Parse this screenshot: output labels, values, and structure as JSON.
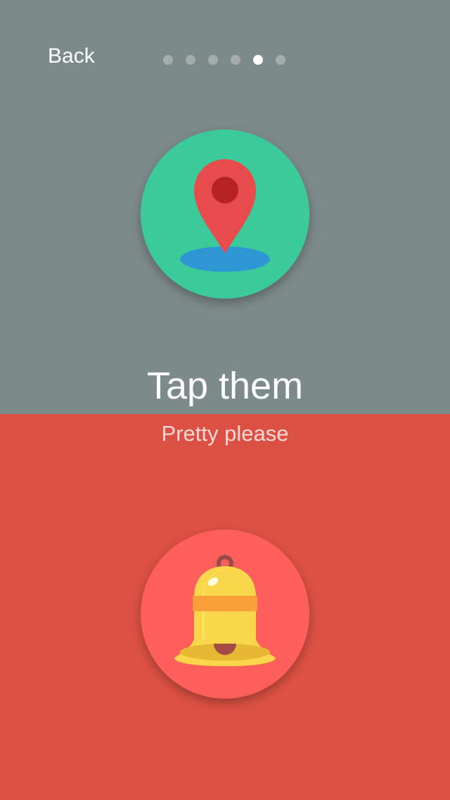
{
  "nav": {
    "back_label": "Back",
    "page_count": 6,
    "active_page": 5
  },
  "onboarding": {
    "title": "Tap them",
    "subtitle": "Pretty please",
    "icons": [
      "map-pin-icon",
      "bell-icon"
    ]
  },
  "colors": {
    "top_background": "#7d8a8a",
    "bottom_background": "#dc5143",
    "location_circle": "#3bcb9a",
    "bell_circle": "#fe5f5b",
    "dot_active": "#ffffff",
    "dot_inactive": "rgba(255,255,255,0.30)"
  }
}
